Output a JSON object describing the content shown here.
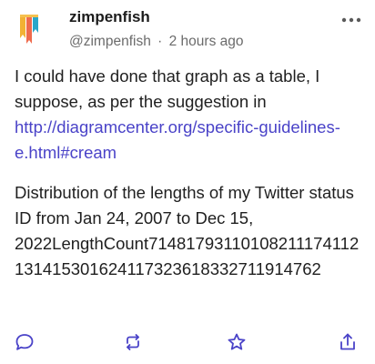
{
  "author": {
    "display_name": "zimpenfish",
    "handle": "@zimpenfish",
    "separator": "·",
    "time": "2 hours ago"
  },
  "avatar": {
    "icon": "bookmark-stripes-logo",
    "colors": [
      "#f2b134",
      "#ef6a4c",
      "#2aa6c9"
    ]
  },
  "menu_icon": "more-icon",
  "post": {
    "intro": "I could have done that graph as a table, I suppose, as per the suggestion in ",
    "link": "http://diagramcenter.org/specific-guidelines-e.html#cream",
    "body": "Distribution of the lengths of my Twitter status ID from Jan 24, 2007 to Dec 15, 2022LengthCount71481793110108211174112131415301624117323618332711914762"
  },
  "actions": [
    "reply-icon",
    "boost-icon",
    "favourite-icon",
    "share-icon"
  ],
  "colors": {
    "link": "#4a43c8",
    "text": "#1f1f1f",
    "muted": "#6b6b6b",
    "icon": "#4a43c8"
  }
}
